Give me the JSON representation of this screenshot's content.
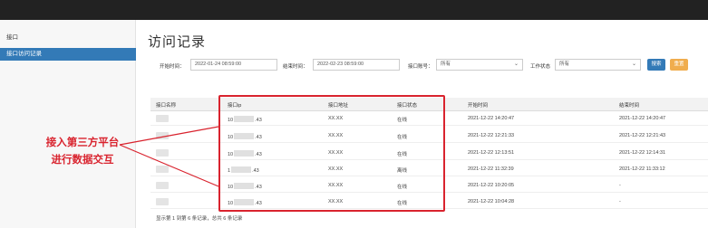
{
  "sidebar": {
    "items": [
      {
        "label": "接口"
      },
      {
        "label": "接口访问记录"
      }
    ]
  },
  "page": {
    "title": "访问记录"
  },
  "filters": {
    "start_label": "开始时间：",
    "start_value": "2022-01-24 08:59:00",
    "end_label": "结束时间：",
    "end_value": "2022-02-23 08:59:00",
    "account_label": "接口账号：",
    "account_value": "所有",
    "status_label": "工作状态",
    "status_value": "所有",
    "search_button": "搜索",
    "reset_button": "重置"
  },
  "table": {
    "headers": [
      "接口名称",
      "接口ip",
      "接口地址",
      "接口状态",
      "开始时间",
      "结束时间"
    ],
    "rows": [
      {
        "ip_prefix": "10",
        "ip_suffix": ".43",
        "address": "XX.XX",
        "status": "在线",
        "start": "2021-12-22 14:20:47",
        "end": "2021-12-22 14:20:47"
      },
      {
        "ip_prefix": "10",
        "ip_suffix": ".43",
        "address": "XX.XX",
        "status": "在线",
        "start": "2021-12-22 12:21:33",
        "end": "2021-12-22 12:21:43"
      },
      {
        "ip_prefix": "10",
        "ip_suffix": ".43",
        "address": "XX.XX",
        "status": "在线",
        "start": "2021-12-22 12:13:51",
        "end": "2021-12-22 12:14:31"
      },
      {
        "ip_prefix": "1",
        "ip_suffix": ".43",
        "address": "XX.XX",
        "status": "离线",
        "start": "2021-12-22 11:32:39",
        "end": "2021-12-22 11:33:12"
      },
      {
        "ip_prefix": "10",
        "ip_suffix": ".43",
        "address": "XX.XX",
        "status": "在线",
        "start": "2021-12-22 10:20:05",
        "end": "-"
      },
      {
        "ip_prefix": "10",
        "ip_suffix": ".43",
        "address": "XX.XX",
        "status": "在线",
        "start": "2021-12-22 10:04:28",
        "end": "-"
      }
    ]
  },
  "footer": {
    "info": "显示第 1 到第 6 条记录，总共 6 条记录"
  },
  "annotation": {
    "line1": "接入第三方平台",
    "line2": "进行数据交互",
    "color": "#d9232e"
  }
}
